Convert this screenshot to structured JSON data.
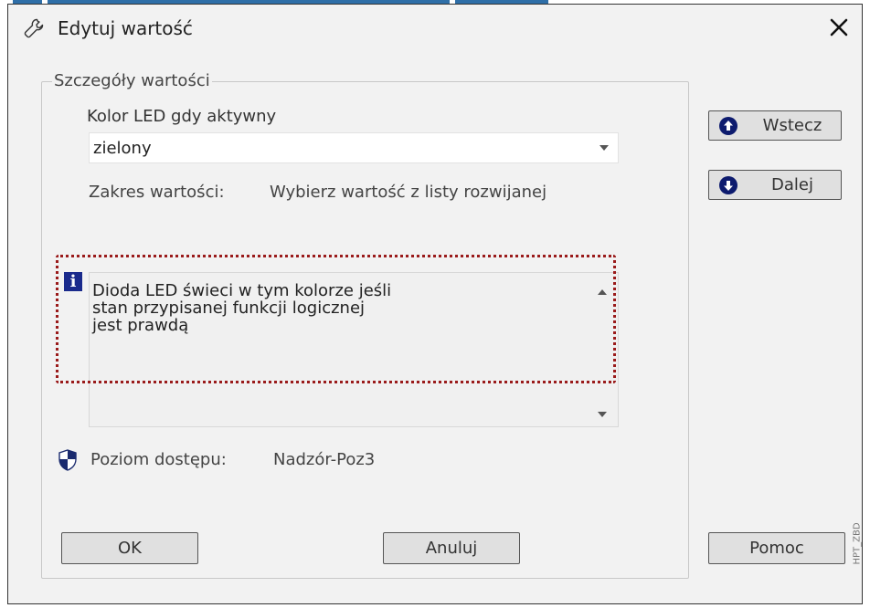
{
  "dialog": {
    "title": "Edytuj wartość",
    "close_icon": "close-icon"
  },
  "group": {
    "legend": "Szczegóły wartości",
    "field_label": "Kolor LED gdy aktywny",
    "select": {
      "value": "zielony"
    },
    "range": {
      "label": "Zakres wartości:",
      "value": "Wybierz wartość z listy rozwijanej"
    },
    "info_icon_letter": "i",
    "description": "Dioda LED świeci w tym kolorze jeśli\nstan przypisanej funkcji logicznej\njest prawdą",
    "access": {
      "label": "Poziom dostępu:",
      "value": "Nadzór-Poz3"
    }
  },
  "nav": {
    "back_label": "Wstecz",
    "next_label": "Dalej"
  },
  "buttons": {
    "ok_label": "OK",
    "cancel_label": "Anuluj",
    "help_label": "Pomoc"
  },
  "watermark": "HPT_ZBD",
  "colors": {
    "highlight": "#9a1b1b",
    "info_icon": "#1a2a8c",
    "nav_icon": "#0d1b6e"
  }
}
